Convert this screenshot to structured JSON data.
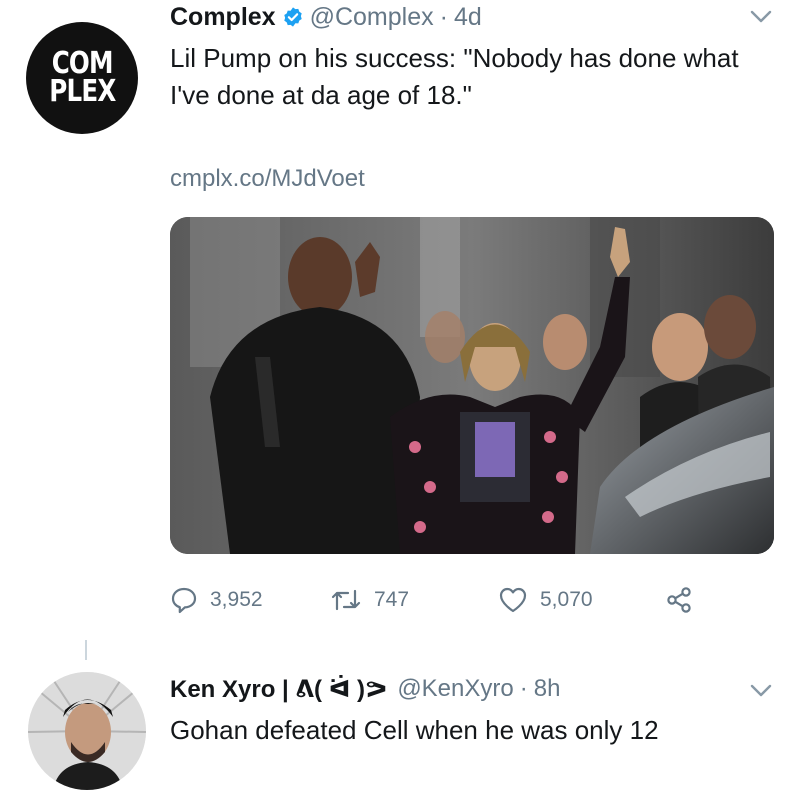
{
  "tweet": {
    "avatar_logo_lines": [
      "COM",
      "PLEX"
    ],
    "display_name": "Complex",
    "handle": "@Complex",
    "separator": "·",
    "time": "4d",
    "text": "Lil Pump on his success: \"Nobody has done what I've done at da age of 18.\"",
    "link": "cmplx.co/MJdVoet",
    "actions": {
      "reply_count": "3,952",
      "retweet_count": "747",
      "like_count": "5,070"
    }
  },
  "reply": {
    "display_name": "Ken Xyro | ᕕ( ᐛ )ᕗ",
    "handle": "@KenXyro",
    "separator": "·",
    "time": "8h",
    "text": "Gohan defeated Cell when he was only 12"
  },
  "icons": {
    "verified": "verified-badge-icon",
    "chevron": "chevron-down-icon",
    "reply": "reply-bubble-icon",
    "retweet": "retweet-icon",
    "like": "heart-icon",
    "share": "share-icon"
  },
  "colors": {
    "text": "#14171a",
    "muted": "#657786",
    "verified_blue": "#1da1f2",
    "logo_bg": "#111111"
  }
}
